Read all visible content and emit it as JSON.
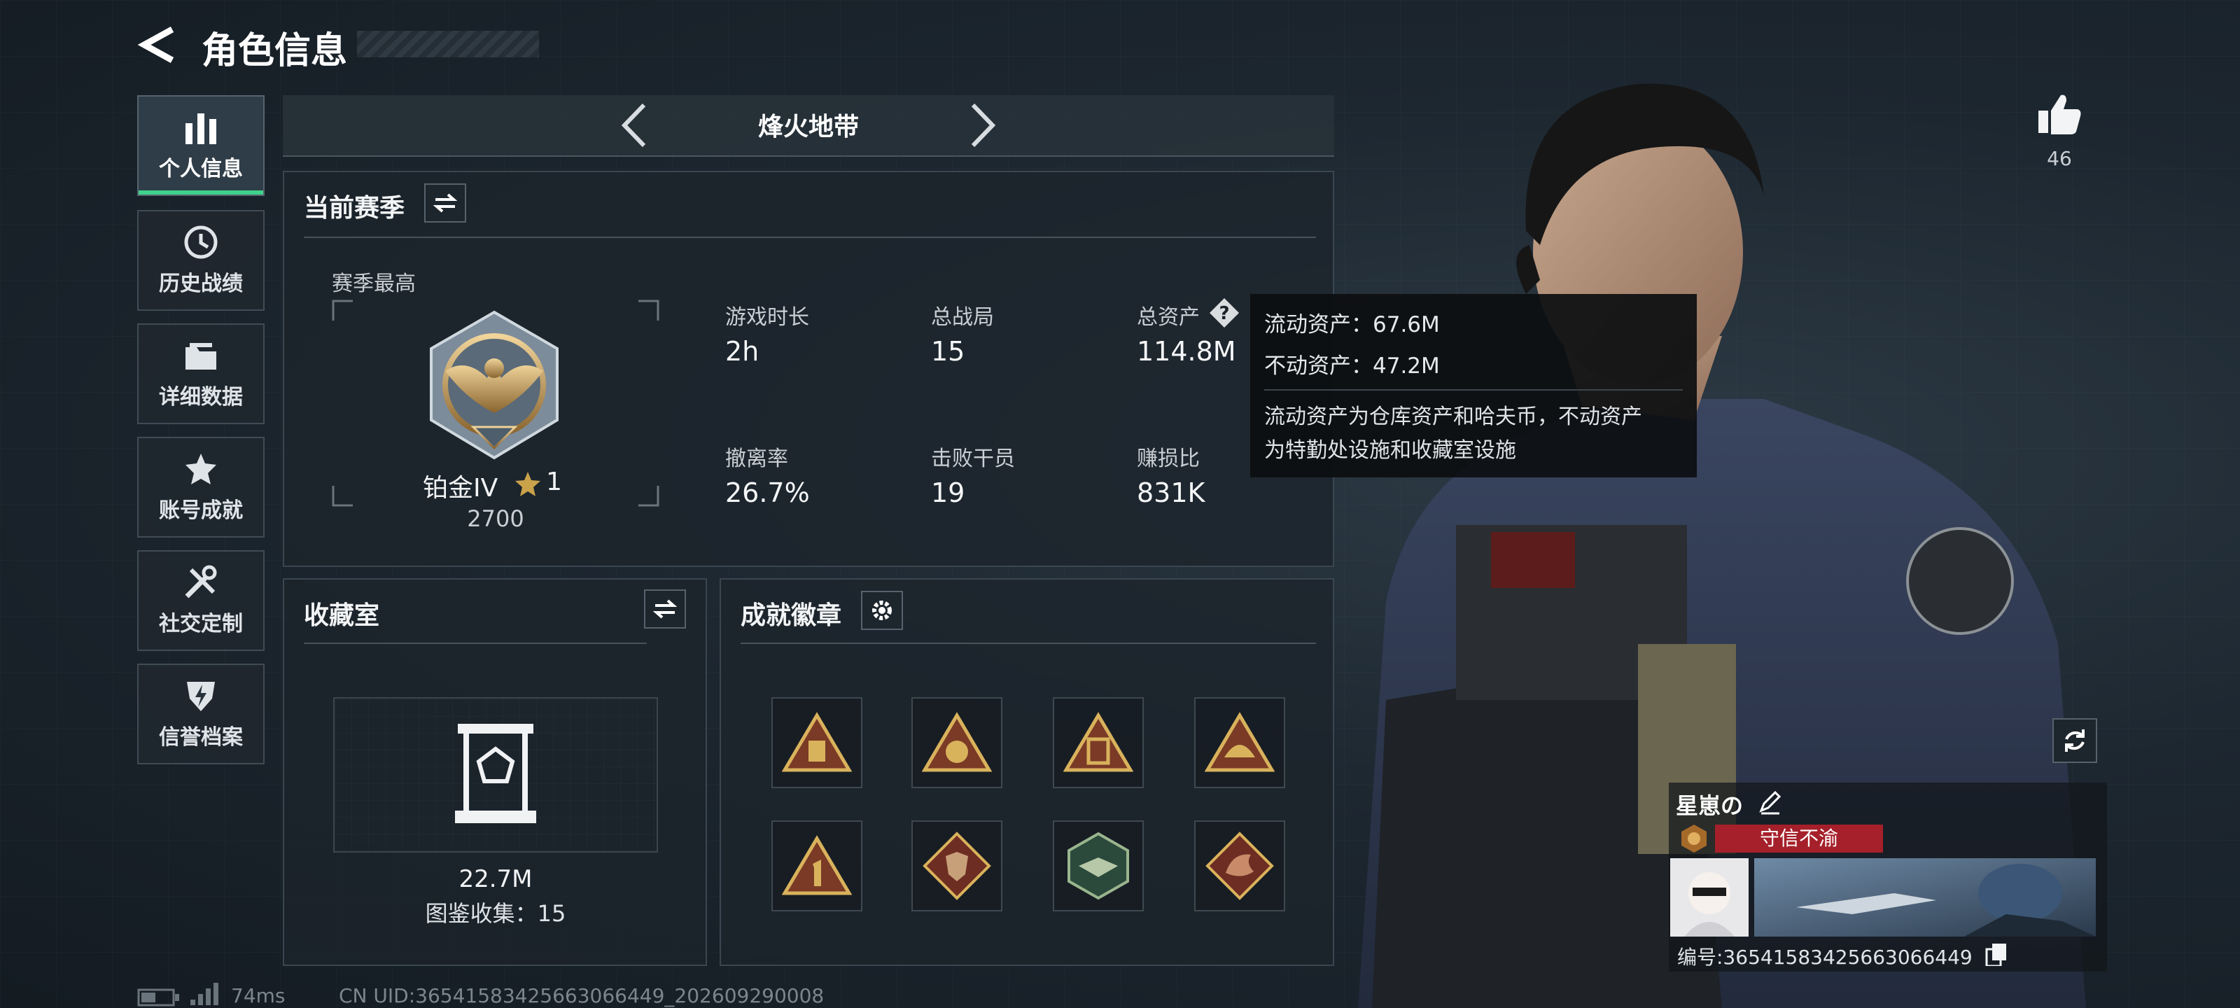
{
  "header": {
    "title": "角色信息"
  },
  "sidebar": {
    "items": [
      {
        "label": "个人信息",
        "icon": "bar-chart-icon",
        "active": true
      },
      {
        "label": "历史战绩",
        "icon": "history-clock-icon",
        "active": false
      },
      {
        "label": "详细数据",
        "icon": "folder-icon",
        "active": false
      },
      {
        "label": "账号成就",
        "icon": "achievement-star-icon",
        "active": false
      },
      {
        "label": "社交定制",
        "icon": "tools-icon",
        "active": false
      },
      {
        "label": "信誉档案",
        "icon": "shield-lightning-icon",
        "active": false
      }
    ]
  },
  "mode_selector": {
    "label": "烽火地带"
  },
  "season": {
    "title": "当前赛季",
    "best_label": "赛季最高",
    "rank_name": "铂金IV",
    "rank_stars": "1",
    "rank_points": "2700",
    "stats": [
      {
        "label": "游戏时长",
        "value": "2h"
      },
      {
        "label": "总战局",
        "value": "15"
      },
      {
        "label": "总资产",
        "value": "114.8M"
      },
      {
        "label": "撤离率",
        "value": "26.7%"
      },
      {
        "label": "击败干员",
        "value": "19"
      },
      {
        "label": "赚损比",
        "value": "831K"
      }
    ]
  },
  "tooltip": {
    "liquid": "流动资产：67.6M",
    "fixed": "不动资产：47.2M",
    "desc_line1": "流动资产为仓库资产和哈夫币，不动资产",
    "desc_line2": "为特勤处设施和收藏室设施"
  },
  "collection": {
    "title": "收藏室",
    "value": "22.7M",
    "collect_label": "图鉴收集：15"
  },
  "achievements": {
    "title": "成就徽章",
    "badges": [
      "badge-1",
      "badge-2",
      "badge-3",
      "badge-4",
      "badge-5",
      "badge-6",
      "badge-7",
      "badge-8"
    ]
  },
  "likes": {
    "count": "46"
  },
  "player_card": {
    "name": "星崽の",
    "title_badge": "守信不渝",
    "id_text": "编号:3654158342566306644​9"
  },
  "footer": {
    "ping": "74ms",
    "uid": "CN UID:36541583425663066449_202609290008"
  },
  "colors": {
    "accent_green": "#3fd28a",
    "title_red": "#a5202a",
    "gold": "#c9a24a"
  }
}
